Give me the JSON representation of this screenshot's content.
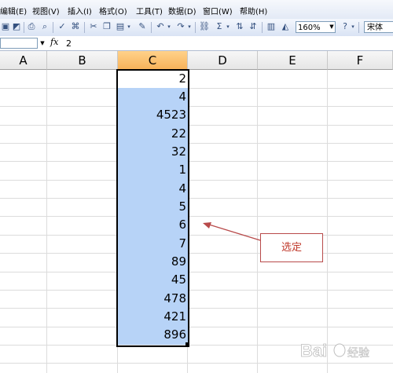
{
  "menu": {
    "items": [
      "编辑(E)",
      "视图(V)",
      "插入(I)",
      "格式(O)",
      "工具(T)",
      "数据(D)",
      "窗口(W)",
      "帮助(H)"
    ]
  },
  "toolbar": {
    "zoom": "160%",
    "font": "宋体"
  },
  "formula_bar": {
    "fx_label": "fx",
    "value": "2"
  },
  "grid": {
    "columns": [
      "A",
      "B",
      "C",
      "D",
      "E",
      "F"
    ],
    "selected_column": "C",
    "column_c_values": [
      "2",
      "4",
      "4523",
      "22",
      "32",
      "1",
      "4",
      "5",
      "6",
      "7",
      "89",
      "45",
      "478",
      "421",
      "896"
    ]
  },
  "annotation": {
    "label": "选定",
    "color": "#c0392b"
  },
  "watermark": {
    "text": "Bai 经验"
  },
  "colors": {
    "selection_fill": "#b7d3f7",
    "header_selected": "#f7b25a"
  }
}
